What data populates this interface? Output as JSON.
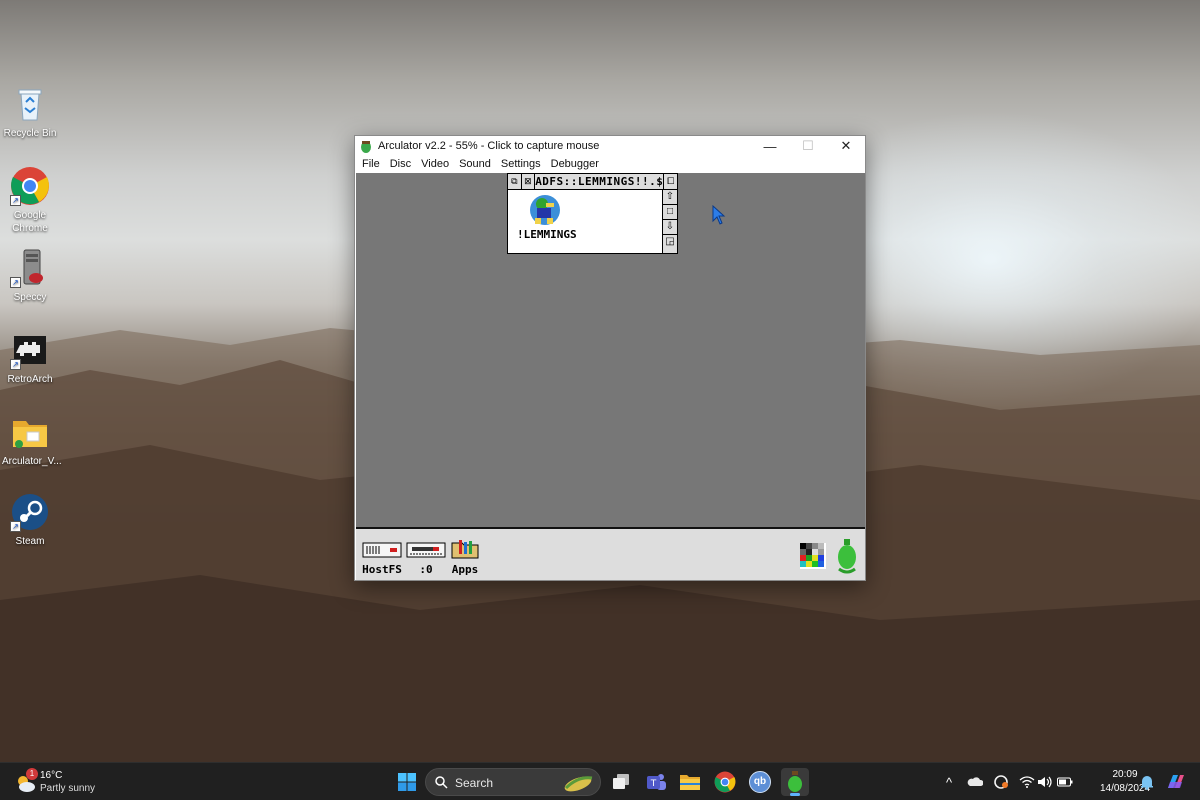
{
  "desktop": {
    "icons": [
      {
        "label": "Recycle Bin",
        "icon": "recycle-bin-icon"
      },
      {
        "label": "Google Chrome",
        "icon": "chrome-icon"
      },
      {
        "label": "Speccy",
        "icon": "speccy-icon"
      },
      {
        "label": "RetroArch",
        "icon": "retroarch-icon"
      },
      {
        "label": "Arculator_V...",
        "icon": "folder-icon"
      },
      {
        "label": "Steam",
        "icon": "steam-icon"
      }
    ]
  },
  "emulator": {
    "title": "Arculator v2.2 - 55% - Click to capture mouse",
    "menu": [
      "File",
      "Disc",
      "Video",
      "Sound",
      "Settings",
      "Debugger"
    ],
    "controls": {
      "minimize": "—",
      "maximize": "☐",
      "close": "✕"
    },
    "filer": {
      "title": "ADFS::LEMMINGS!!.$",
      "file_label": "!LEMMINGS"
    },
    "iconbar": {
      "items": [
        {
          "label": "HostFS",
          "icon": "hostfs-drive-icon"
        },
        {
          "label": ":0",
          "icon": "floppy-drive-icon"
        },
        {
          "label": "Apps",
          "icon": "apps-folder-icon"
        }
      ],
      "right_icons": [
        "display-palette-icon",
        "acorn-icon"
      ]
    }
  },
  "taskbar": {
    "weather": {
      "badge": "1",
      "temp": "16°C",
      "condition": "Partly sunny"
    },
    "search_placeholder": "Search",
    "pinned": [
      "windows-start-icon",
      "task-view-icon",
      "teams-icon",
      "file-explorer-icon",
      "chrome-icon",
      "qbittorrent-icon",
      "arculator-icon"
    ],
    "qb_label": "qb",
    "tray": {
      "chevron": "^"
    },
    "clock": {
      "time": "20:09",
      "date": "14/08/2024"
    }
  },
  "colors": {
    "taskbar_bg": "#202020",
    "emulator_desktop": "#777777",
    "iconbar_bg": "#dddddd",
    "riscos_grey": "#dddddd"
  }
}
